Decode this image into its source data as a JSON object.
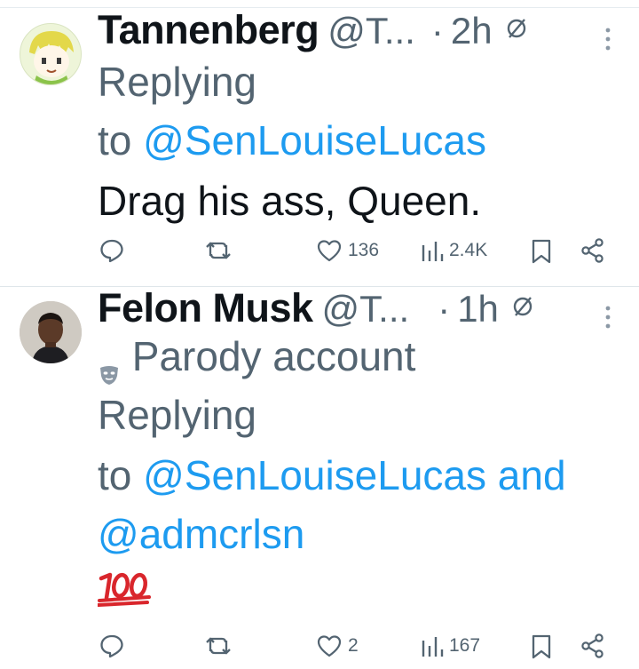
{
  "tweets": [
    {
      "name": "Tannenberg",
      "handle": "@T...",
      "dot": "·",
      "time": "2h",
      "parody_label": "",
      "replying_word": "Replying",
      "to_word": "to",
      "mention_1": "@SenLouiseLucas",
      "and_word": "",
      "mention_2": "",
      "text": "Drag his ass, Queen.",
      "likes": "136",
      "views": "2.4K"
    },
    {
      "name": "Felon Musk",
      "handle": "@T...",
      "dot": "·",
      "time": "1h",
      "parody_label": "Parody account",
      "replying_word": "Replying",
      "to_word": "to",
      "mention_1": "@SenLouiseLucas",
      "and_word": "and",
      "mention_2": "@admcrlsn",
      "text": "💯",
      "likes": "2",
      "views": "167"
    }
  ],
  "colors": {
    "link": "#1d9bf0",
    "text": "#0f1419",
    "secondary": "#536471",
    "separator": "#dfe6ea"
  },
  "icons": [
    "reply-icon",
    "retweet-icon",
    "like-icon",
    "views-icon",
    "bookmark-icon",
    "share-icon",
    "history-icon",
    "more-icon",
    "parody-mask-icon"
  ]
}
